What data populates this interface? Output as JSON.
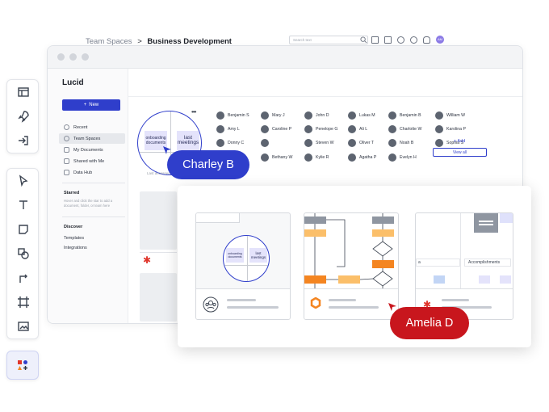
{
  "app": {
    "logo_text": "Lucid",
    "new_button": "New",
    "nav_items": [
      "Recent",
      "Team Spaces",
      "My Documents",
      "Shared with Me",
      "Data Hub"
    ],
    "active_nav": "Team Spaces",
    "starred_heading": "Starred",
    "starred_hint": "Hover and click the star to add a document, folder, or team here",
    "discover_heading": "Discover",
    "discover_links": [
      "Templates",
      "Integrations"
    ]
  },
  "header": {
    "breadcrumb_parent": "Team Spaces",
    "breadcrumb_separator": ">",
    "breadcrumb_current": "Business Development",
    "search_placeholder": "Search text",
    "user_initials": "AM"
  },
  "members": [
    [
      "Benjamin S",
      "Mary J",
      "John D",
      "Lukas M",
      "Benjamin B",
      "William W"
    ],
    [
      "Amy L",
      "Caroline P",
      "Penelope G",
      "Ali L",
      "Charlotte W",
      "Karolina P"
    ],
    [
      "Donny C",
      "",
      "Steven W",
      "Oliver T",
      "Noah B",
      "Sophia S"
    ],
    [
      "",
      "Bethany W",
      "Kylie R",
      "Agatha P",
      "Evelyn H",
      ""
    ]
  ],
  "add_label": "+ Add",
  "view_all_label": "View all",
  "card_preview": {
    "sticky_1": "onboarding documents",
    "sticky_2": "last meetings",
    "last_accessed": "Last accessed"
  },
  "collaborators": {
    "charley": {
      "name": "Charley B",
      "color": "#2f3ecb"
    },
    "amelia": {
      "name": "Amelia D",
      "color": "#c8161d"
    }
  },
  "panel": {
    "sticky_1": "onboarding documents",
    "sticky_2": "last meetings",
    "column_header": "Accomplishments"
  },
  "colors": {
    "brand_blue": "#2f3ecb",
    "flow_orange": "#f48521",
    "flow_light_orange": "#fbbf6a",
    "red_accent": "#e0352b"
  }
}
